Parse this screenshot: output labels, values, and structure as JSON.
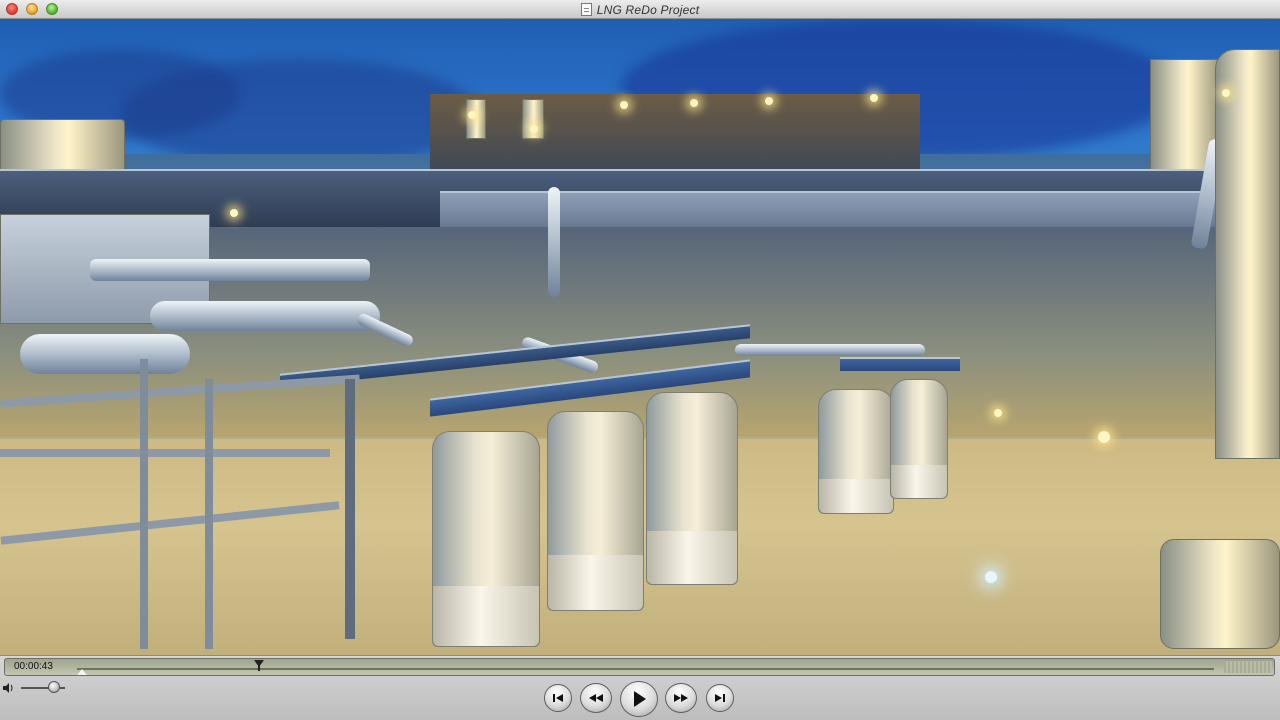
{
  "window": {
    "title": "LNG ReDo Project"
  },
  "video": {
    "description_icon": "industrial-lng-plant-frame"
  },
  "controller": {
    "current_time": "00:00:43",
    "playhead_progress": 0.16,
    "volume_level": 0.75,
    "buttons": {
      "go_to_start": "skip-to-start-icon",
      "rewind": "rewind-icon",
      "play": "play-icon",
      "fast_forward": "fast-forward-icon",
      "go_to_end": "skip-to-end-icon"
    }
  },
  "colors": {
    "titlebar": "#d9d9d9",
    "scrubber": "#b3b79f",
    "sky": "#2d76cc",
    "lights": "#fff6c0"
  }
}
